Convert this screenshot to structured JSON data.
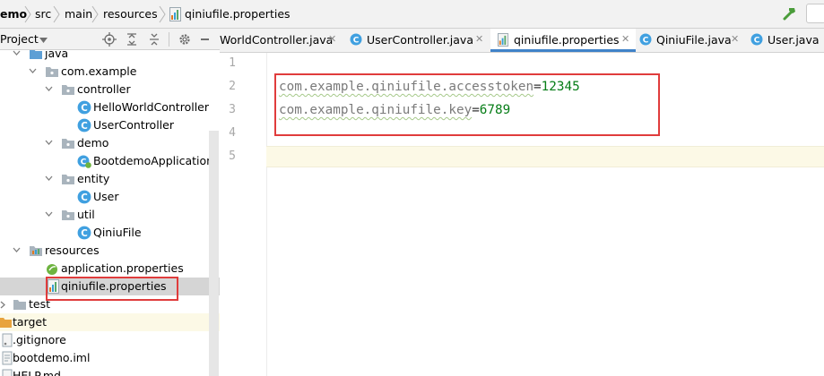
{
  "breadcrumb": [
    "emo",
    "src",
    "main",
    "resources",
    "qiniufile.properties"
  ],
  "project_panel": {
    "title": "Project"
  },
  "tabs": [
    {
      "label": "WorldController.java",
      "icon": "class-icon"
    },
    {
      "label": "UserController.java",
      "icon": "class-icon"
    },
    {
      "label": "qiniufile.properties",
      "icon": "properties-icon",
      "active": true
    },
    {
      "label": "QiniuFile.java",
      "icon": "class-icon"
    },
    {
      "label": "User.java",
      "icon": "class-icon"
    }
  ],
  "tree": [
    {
      "label": "java",
      "type": "folder-blue"
    },
    {
      "label": "com.example",
      "type": "package"
    },
    {
      "label": "controller",
      "type": "package"
    },
    {
      "label": "HelloWorldController",
      "type": "class"
    },
    {
      "label": "UserController",
      "type": "class"
    },
    {
      "label": "demo",
      "type": "package"
    },
    {
      "label": "BootdemoApplication",
      "type": "spring-class"
    },
    {
      "label": "entity",
      "type": "package"
    },
    {
      "label": "User",
      "type": "class"
    },
    {
      "label": "util",
      "type": "package"
    },
    {
      "label": "QiniuFile",
      "type": "class"
    },
    {
      "label": "resources",
      "type": "resources-folder"
    },
    {
      "label": "application.properties",
      "type": "spring-properties"
    },
    {
      "label": "qiniufile.properties",
      "type": "properties",
      "selected": true
    },
    {
      "label": "test",
      "type": "folder"
    },
    {
      "label": "target",
      "type": "folder-orange"
    },
    {
      "label": ".gitignore",
      "type": "file"
    },
    {
      "label": "bootdemo.iml",
      "type": "file"
    },
    {
      "label": "HELP.md",
      "type": "file"
    }
  ],
  "editor": {
    "line_numbers": [
      "1",
      "2",
      "3",
      "4",
      "5"
    ],
    "line2": {
      "key": "com.example.qiniufile.accesstoken",
      "eq": "=",
      "value": "12345"
    },
    "line3": {
      "key": "com.example.qiniufile.key",
      "eq": "=",
      "value": "6789"
    }
  },
  "colors": {
    "highlight": "#e03c3c",
    "tab_accent": "#4083c9",
    "value": "#067d17"
  }
}
